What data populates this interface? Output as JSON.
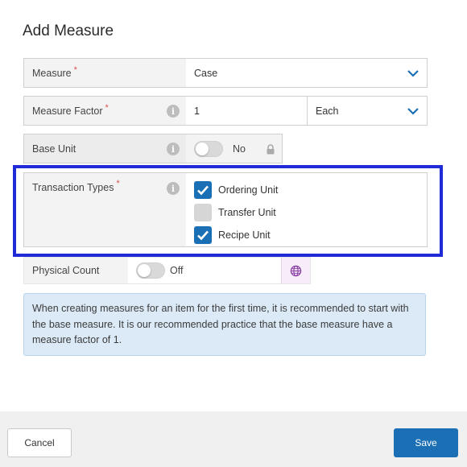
{
  "dialog": {
    "title": "Add Measure"
  },
  "fields": {
    "measure": {
      "label": "Measure",
      "required": "*",
      "value": "Case"
    },
    "measure_factor": {
      "label": "Measure Factor",
      "required": "*",
      "value": "1",
      "unit": "Each"
    },
    "base_unit": {
      "label": "Base Unit",
      "toggle_text": "No"
    },
    "transaction_types": {
      "label": "Transaction Types",
      "required": "*",
      "options": [
        {
          "label": "Ordering Unit",
          "checked": true
        },
        {
          "label": "Transfer Unit",
          "checked": false
        },
        {
          "label": "Recipe Unit",
          "checked": true
        }
      ]
    },
    "physical_count": {
      "label": "Physical Count",
      "toggle_text": "Off"
    }
  },
  "notice": {
    "text": "When creating measures for an item for the first time, it is recommended to start with the base measure. It is our recommended practice that the base measure have a measure factor of 1."
  },
  "footer": {
    "cancel_label": "Cancel",
    "save_label": "Save"
  },
  "colors": {
    "accent": "#1a6fb5",
    "highlight": "#1f2bd6",
    "notice_bg": "#dbeaf6"
  },
  "icons": {
    "info": "info-icon",
    "dropdown": "chevron-down-icon",
    "lock": "lock-icon",
    "globe": "globe-icon",
    "check": "check-icon"
  }
}
